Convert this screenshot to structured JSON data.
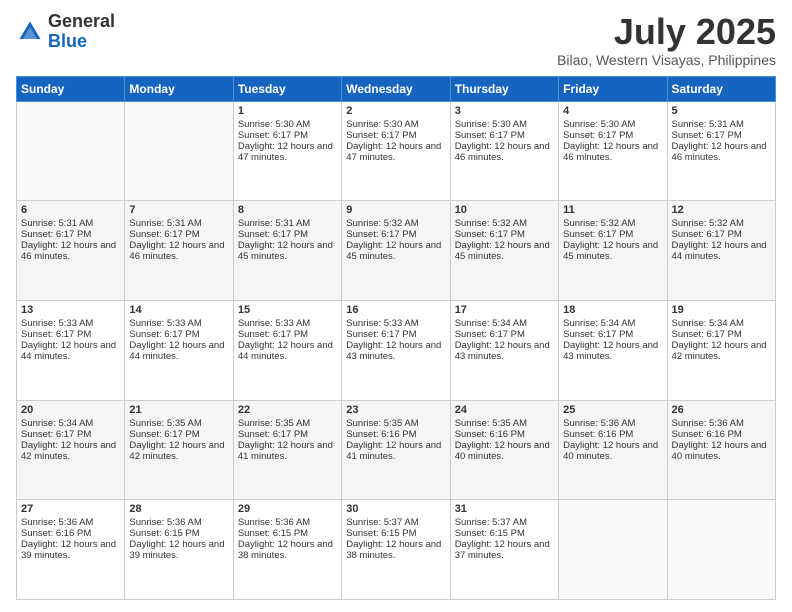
{
  "header": {
    "logo_general": "General",
    "logo_blue": "Blue",
    "main_title": "July 2025",
    "subtitle": "Bilao, Western Visayas, Philippines"
  },
  "days_of_week": [
    "Sunday",
    "Monday",
    "Tuesday",
    "Wednesday",
    "Thursday",
    "Friday",
    "Saturday"
  ],
  "weeks": [
    [
      {
        "day": "",
        "info": ""
      },
      {
        "day": "",
        "info": ""
      },
      {
        "day": "1",
        "info": "Sunrise: 5:30 AM\nSunset: 6:17 PM\nDaylight: 12 hours and 47 minutes."
      },
      {
        "day": "2",
        "info": "Sunrise: 5:30 AM\nSunset: 6:17 PM\nDaylight: 12 hours and 47 minutes."
      },
      {
        "day": "3",
        "info": "Sunrise: 5:30 AM\nSunset: 6:17 PM\nDaylight: 12 hours and 46 minutes."
      },
      {
        "day": "4",
        "info": "Sunrise: 5:30 AM\nSunset: 6:17 PM\nDaylight: 12 hours and 46 minutes."
      },
      {
        "day": "5",
        "info": "Sunrise: 5:31 AM\nSunset: 6:17 PM\nDaylight: 12 hours and 46 minutes."
      }
    ],
    [
      {
        "day": "6",
        "info": "Sunrise: 5:31 AM\nSunset: 6:17 PM\nDaylight: 12 hours and 46 minutes."
      },
      {
        "day": "7",
        "info": "Sunrise: 5:31 AM\nSunset: 6:17 PM\nDaylight: 12 hours and 46 minutes."
      },
      {
        "day": "8",
        "info": "Sunrise: 5:31 AM\nSunset: 6:17 PM\nDaylight: 12 hours and 45 minutes."
      },
      {
        "day": "9",
        "info": "Sunrise: 5:32 AM\nSunset: 6:17 PM\nDaylight: 12 hours and 45 minutes."
      },
      {
        "day": "10",
        "info": "Sunrise: 5:32 AM\nSunset: 6:17 PM\nDaylight: 12 hours and 45 minutes."
      },
      {
        "day": "11",
        "info": "Sunrise: 5:32 AM\nSunset: 6:17 PM\nDaylight: 12 hours and 45 minutes."
      },
      {
        "day": "12",
        "info": "Sunrise: 5:32 AM\nSunset: 6:17 PM\nDaylight: 12 hours and 44 minutes."
      }
    ],
    [
      {
        "day": "13",
        "info": "Sunrise: 5:33 AM\nSunset: 6:17 PM\nDaylight: 12 hours and 44 minutes."
      },
      {
        "day": "14",
        "info": "Sunrise: 5:33 AM\nSunset: 6:17 PM\nDaylight: 12 hours and 44 minutes."
      },
      {
        "day": "15",
        "info": "Sunrise: 5:33 AM\nSunset: 6:17 PM\nDaylight: 12 hours and 44 minutes."
      },
      {
        "day": "16",
        "info": "Sunrise: 5:33 AM\nSunset: 6:17 PM\nDaylight: 12 hours and 43 minutes."
      },
      {
        "day": "17",
        "info": "Sunrise: 5:34 AM\nSunset: 6:17 PM\nDaylight: 12 hours and 43 minutes."
      },
      {
        "day": "18",
        "info": "Sunrise: 5:34 AM\nSunset: 6:17 PM\nDaylight: 12 hours and 43 minutes."
      },
      {
        "day": "19",
        "info": "Sunrise: 5:34 AM\nSunset: 6:17 PM\nDaylight: 12 hours and 42 minutes."
      }
    ],
    [
      {
        "day": "20",
        "info": "Sunrise: 5:34 AM\nSunset: 6:17 PM\nDaylight: 12 hours and 42 minutes."
      },
      {
        "day": "21",
        "info": "Sunrise: 5:35 AM\nSunset: 6:17 PM\nDaylight: 12 hours and 42 minutes."
      },
      {
        "day": "22",
        "info": "Sunrise: 5:35 AM\nSunset: 6:17 PM\nDaylight: 12 hours and 41 minutes."
      },
      {
        "day": "23",
        "info": "Sunrise: 5:35 AM\nSunset: 6:16 PM\nDaylight: 12 hours and 41 minutes."
      },
      {
        "day": "24",
        "info": "Sunrise: 5:35 AM\nSunset: 6:16 PM\nDaylight: 12 hours and 40 minutes."
      },
      {
        "day": "25",
        "info": "Sunrise: 5:36 AM\nSunset: 6:16 PM\nDaylight: 12 hours and 40 minutes."
      },
      {
        "day": "26",
        "info": "Sunrise: 5:36 AM\nSunset: 6:16 PM\nDaylight: 12 hours and 40 minutes."
      }
    ],
    [
      {
        "day": "27",
        "info": "Sunrise: 5:36 AM\nSunset: 6:16 PM\nDaylight: 12 hours and 39 minutes."
      },
      {
        "day": "28",
        "info": "Sunrise: 5:36 AM\nSunset: 6:15 PM\nDaylight: 12 hours and 39 minutes."
      },
      {
        "day": "29",
        "info": "Sunrise: 5:36 AM\nSunset: 6:15 PM\nDaylight: 12 hours and 38 minutes."
      },
      {
        "day": "30",
        "info": "Sunrise: 5:37 AM\nSunset: 6:15 PM\nDaylight: 12 hours and 38 minutes."
      },
      {
        "day": "31",
        "info": "Sunrise: 5:37 AM\nSunset: 6:15 PM\nDaylight: 12 hours and 37 minutes."
      },
      {
        "day": "",
        "info": ""
      },
      {
        "day": "",
        "info": ""
      }
    ]
  ]
}
